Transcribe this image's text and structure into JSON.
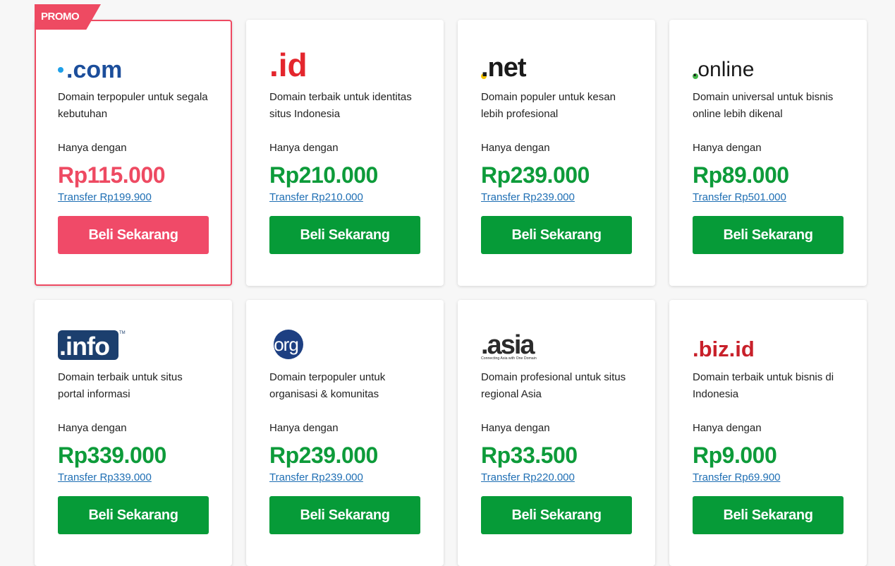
{
  "promo_badge": "PROMO",
  "cards": [
    {
      "tld": ".com",
      "desc": "Domain terpopuler untuk segala kebutuhan",
      "label": "Hanya dengan",
      "price": "Rp115.000",
      "transfer": "Transfer Rp199.900",
      "button": "Beli Sekarang",
      "promo": true
    },
    {
      "tld": ".id",
      "desc": "Domain terbaik untuk identitas situs Indonesia",
      "label": "Hanya dengan",
      "price": "Rp210.000",
      "transfer": "Transfer Rp210.000",
      "button": "Beli Sekarang"
    },
    {
      "tld": ".net",
      "desc": "Domain populer untuk kesan lebih profesional",
      "label": "Hanya dengan",
      "price": "Rp239.000",
      "transfer": "Transfer Rp239.000",
      "button": "Beli Sekarang"
    },
    {
      "tld": ".online",
      "desc": "Domain universal untuk bisnis online lebih dikenal",
      "label": "Hanya dengan",
      "price": "Rp89.000",
      "transfer": "Transfer Rp501.000",
      "button": "Beli Sekarang"
    },
    {
      "tld": ".info",
      "desc": "Domain terbaik untuk situs portal informasi",
      "label": "Hanya dengan",
      "price": "Rp339.000",
      "transfer": "Transfer Rp339.000",
      "button": "Beli Sekarang"
    },
    {
      "tld": ".org",
      "desc": "Domain terpopuler untuk organisasi & komunitas",
      "label": "Hanya dengan",
      "price": "Rp239.000",
      "transfer": "Transfer Rp239.000",
      "button": "Beli Sekarang"
    },
    {
      "tld": ".asia",
      "tagline": "Connecting Asia with One Domain",
      "desc": "Domain profesional untuk situs regional Asia",
      "label": "Hanya dengan",
      "price": "Rp33.500",
      "transfer": "Transfer Rp220.000",
      "button": "Beli Sekarang"
    },
    {
      "tld": ".biz.id",
      "desc": "Domain terbaik untuk bisnis di Indonesia",
      "label": "Hanya dengan",
      "price": "Rp9.000",
      "transfer": "Transfer Rp69.900",
      "button": "Beli Sekarang"
    }
  ],
  "colors": {
    "promo": "#ee4a62",
    "green": "#069b38",
    "link": "#1f6fb4"
  }
}
